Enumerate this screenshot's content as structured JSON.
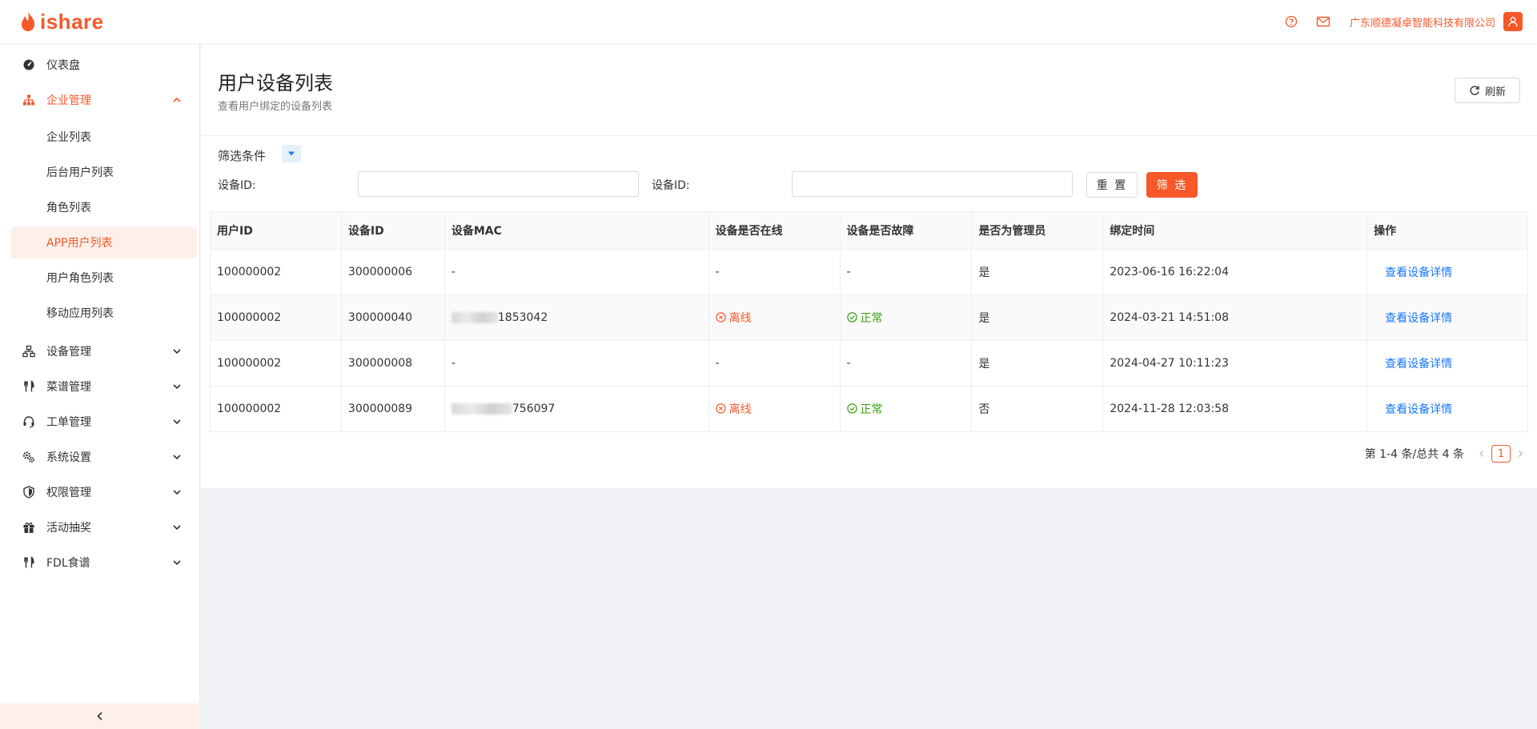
{
  "app": {
    "logo_text": "ishare",
    "brand_color": "#f7582a"
  },
  "header": {
    "icons": [
      "help-circle-icon",
      "mail-icon",
      "user-icon"
    ],
    "company": "广东顺德凝卓智能科技有限公司"
  },
  "sidebar": {
    "items": [
      {
        "label": "仪表盘",
        "icon": "dashboard-icon"
      },
      {
        "label": "企业管理",
        "icon": "org-chart-icon",
        "expanded": true,
        "children": [
          "企业列表",
          "后台用户列表",
          "角色列表",
          "APP用户列表",
          "用户角色列表",
          "移动应用列表"
        ],
        "selected_child": "APP用户列表"
      },
      {
        "label": "设备管理",
        "icon": "network-icon"
      },
      {
        "label": "菜谱管理",
        "icon": "fork-knife-icon"
      },
      {
        "label": "工单管理",
        "icon": "headset-icon"
      },
      {
        "label": "系统设置",
        "icon": "gears-icon"
      },
      {
        "label": "权限管理",
        "icon": "shield-icon"
      },
      {
        "label": "活动抽奖",
        "icon": "gift-icon"
      },
      {
        "label": "FDL食谱",
        "icon": "fork-knife-icon"
      }
    ],
    "collapse_icon": "chevron-left-icon"
  },
  "page": {
    "title": "用户设备列表",
    "subtitle": "查看用户绑定的设备列表",
    "refresh_label": "刷新"
  },
  "filter": {
    "title": "筛选条件",
    "field1_label": "设备ID:",
    "field1_value": "",
    "field2_label": "设备ID:",
    "field2_value": "",
    "reset_label": "重 置",
    "submit_label": "筛 选"
  },
  "table": {
    "columns": [
      "用户ID",
      "设备ID",
      "设备MAC",
      "设备是否在线",
      "设备是否故障",
      "是否为管理员",
      "绑定时间",
      "操作"
    ],
    "rows": [
      {
        "user_id": "100000002",
        "device_id": "300000006",
        "mac": "-",
        "online": "-",
        "fault": "-",
        "admin": "是",
        "bind_time": "2023-06-16 16:22:04",
        "action": "查看设备详情"
      },
      {
        "user_id": "100000002",
        "device_id": "300000040",
        "mac_visible": "1853042",
        "online": "离线",
        "fault": "正常",
        "admin": "是",
        "bind_time": "2024-03-21 14:51:08",
        "action": "查看设备详情"
      },
      {
        "user_id": "100000002",
        "device_id": "300000008",
        "mac": "-",
        "online": "-",
        "fault": "-",
        "admin": "是",
        "bind_time": "2024-04-27 10:11:23",
        "action": "查看设备详情"
      },
      {
        "user_id": "100000002",
        "device_id": "300000089",
        "mac_visible": "756097",
        "online": "离线",
        "fault": "正常",
        "admin": "否",
        "bind_time": "2024-11-28 12:03:58",
        "action": "查看设备详情"
      }
    ],
    "status_colors": {
      "offline": "#f7582a",
      "normal": "#389e0d",
      "link": "#1677ff"
    }
  },
  "pagination": {
    "summary": "第 1-4 条/总共 4 条",
    "current_page": "1"
  }
}
